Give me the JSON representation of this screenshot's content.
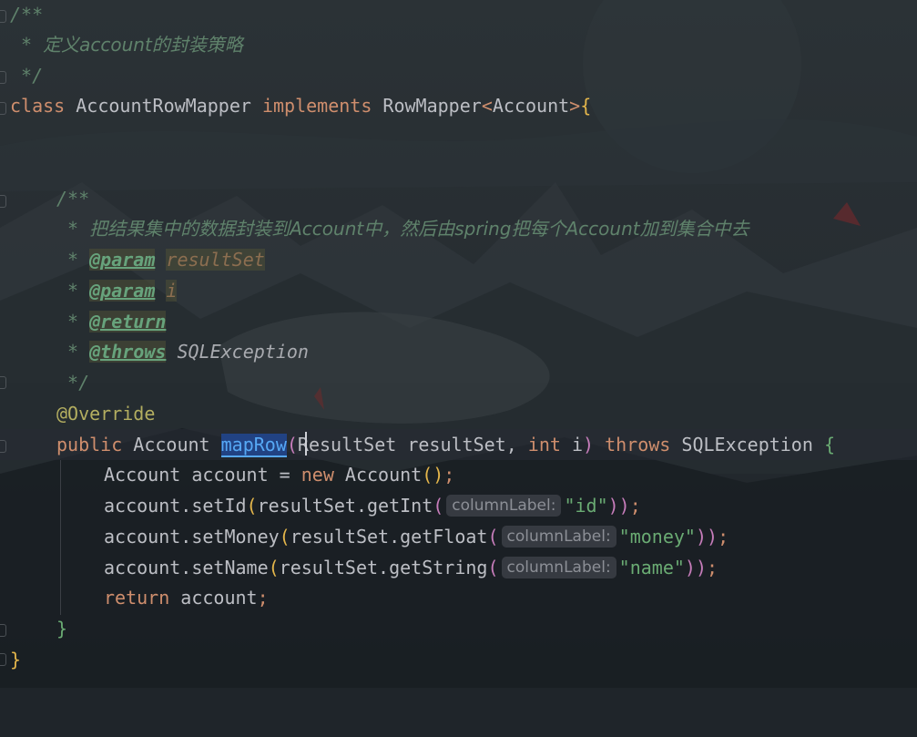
{
  "editor": {
    "lines": {
      "l1": "/**",
      "l2_star": " * ",
      "l2_text": "定义account的封装策略",
      "l3": " */",
      "l4_kw": "class",
      "l4_name": " AccountRowMapper ",
      "l4_impl": "implements",
      "l4_iface": " RowMapper",
      "l4_lt": "<",
      "l4_type": "Account",
      "l4_gt": ">",
      "l4_brace": "{",
      "l7": "/**",
      "l8_star": " * ",
      "l8_text": "把结果集中的数据封装到Account中，然后由spring把每个Account加到集合中去",
      "l9_star": " * ",
      "l9_tag": "@param",
      "l9_val": "resultSet",
      "l10_star": " * ",
      "l10_tag": "@param",
      "l10_val": "i",
      "l11_star": " * ",
      "l11_tag": "@return",
      "l12_star": " * ",
      "l12_tag": "@throws",
      "l12_val": " SQLException",
      "l13": " */",
      "l14": "@Override",
      "l15_public": "public",
      "l15_type": " Account ",
      "l15_method": "mapRow",
      "l15_open": "(",
      "l15_params1": "ResultSet resultSet, ",
      "l15_int": "int",
      "l15_i": " i",
      "l15_close": ")",
      "l15_throws": " throws",
      "l15_exc": " SQLException ",
      "l15_brace": "{",
      "l16_a": "Account account = ",
      "l16_new": "new",
      "l16_b": " Account",
      "l16_paren": "()",
      "l16_semi": ";",
      "l17_a": "account.setId",
      "l17_open": "(",
      "l17_b": "resultSet.getInt",
      "l17_open2": "(",
      "l17_hint": "columnLabel:",
      "l17_str": "\"id\"",
      "l17_close": "))",
      "l17_semi": ";",
      "l18_a": "account.setMoney",
      "l18_open": "(",
      "l18_b": "resultSet.getFloat",
      "l18_open2": "(",
      "l18_hint": "columnLabel:",
      "l18_str": "\"money\"",
      "l18_close": "))",
      "l18_semi": ";",
      "l19_a": "account.setName",
      "l19_open": "(",
      "l19_b": "resultSet.getString",
      "l19_open2": "(",
      "l19_hint": "columnLabel:",
      "l19_str": "\"name\"",
      "l19_close": "))",
      "l19_semi": ";",
      "l20_ret": "return",
      "l20_rest": " account",
      "l20_semi": ";",
      "l21": "}",
      "l22": "}"
    },
    "colors": {
      "keyword": "#cf8e6d",
      "comment": "#5f826b",
      "string": "#6aab73",
      "annotation": "#b3ae60",
      "method_declaration": "#56a8f5",
      "selection": "#214283"
    }
  }
}
